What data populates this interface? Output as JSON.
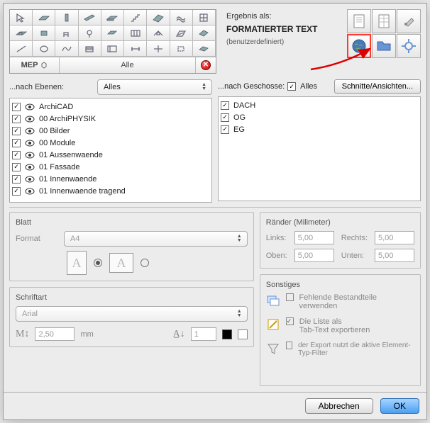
{
  "palette": {
    "mep": "MEP",
    "all": "Alle"
  },
  "result": {
    "title": "Ergebnis als:",
    "mode": "FORMATIERTER TEXT",
    "subtitle": "(benutzerdefiniert)"
  },
  "layerFilter": {
    "label": "...nach Ebenen:",
    "combo": "Alles",
    "items": [
      "ArchiCAD",
      "00 ArchiPHYSIK",
      "00 Bilder",
      "00 Module",
      "01 Aussenwaende",
      "01 Fassade",
      "01 Innenwaende",
      "01 Innenwaende tragend"
    ]
  },
  "storyFilter": {
    "label": "...nach Geschosse:",
    "allLabel": "Alles",
    "button": "Schnitte/Ansichten...",
    "items": [
      "DACH",
      "OG",
      "EG"
    ]
  },
  "sheet": {
    "title": "Blatt",
    "formatLabel": "Format",
    "formatValue": "A4"
  },
  "margins": {
    "title": "Ränder (Milimeter)",
    "left": {
      "label": "Links:",
      "value": "5,00"
    },
    "right": {
      "label": "Rechts:",
      "value": "5,00"
    },
    "top": {
      "label": "Oben:",
      "value": "5,00"
    },
    "bottom": {
      "label": "Unten:",
      "value": "5,00"
    }
  },
  "font": {
    "title": "Schriftart",
    "name": "Arial",
    "size": "2,50",
    "unit": "mm",
    "leading": "1"
  },
  "misc": {
    "title": "Sonstiges",
    "opt1": "Fehlende Bestandteile verwenden",
    "opt2a": "Die Liste als",
    "opt2b": "Tab-Text exportieren",
    "opt3": "der Export nutzt die aktive Element-Typ-Filter"
  },
  "footer": {
    "cancel": "Abbrechen",
    "ok": "OK"
  }
}
